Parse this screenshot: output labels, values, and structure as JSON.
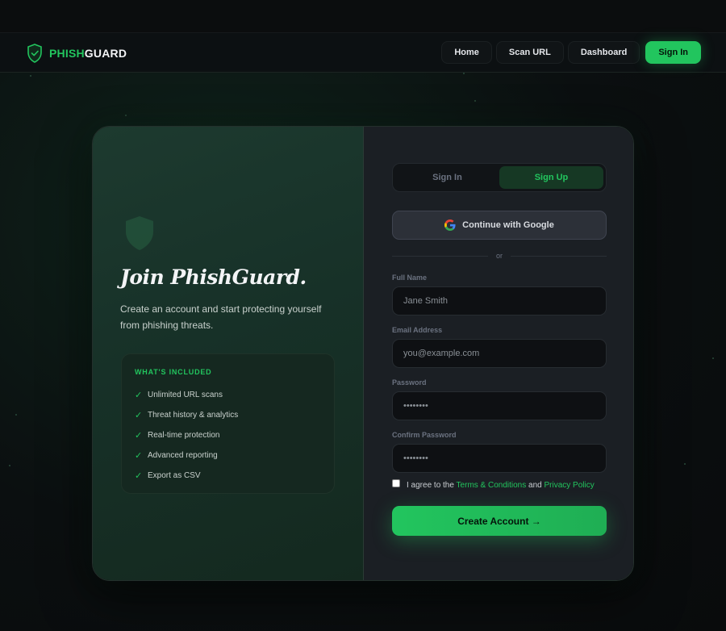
{
  "brand": {
    "part1": "PHISH",
    "part2": "GUARD",
    "accent": "#22c55e"
  },
  "nav": {
    "links": [
      "Home",
      "Scan URL",
      "Dashboard"
    ],
    "signin": "Sign In"
  },
  "promo": {
    "headline": "Join PhishGuard.",
    "subline": "Create an account and start protecting yourself from phishing threats.",
    "included_title": "WHAT'S INCLUDED",
    "items": [
      "Unlimited URL scans",
      "Threat history & analytics",
      "Real-time protection",
      "Advanced reporting",
      "Export as CSV"
    ]
  },
  "auth": {
    "tabs": [
      "Sign In",
      "Sign Up"
    ],
    "active_tab": "Sign Up",
    "google_label": "Continue with Google",
    "divider": "or",
    "fields": {
      "full_name": {
        "label": "Full Name",
        "placeholder": "Jane Smith"
      },
      "email": {
        "label": "Email Address",
        "placeholder": "you@example.com"
      },
      "password": {
        "label": "Password",
        "placeholder": "••••••••"
      },
      "confirm": {
        "label": "Confirm Password",
        "placeholder": "••••••••"
      }
    },
    "agree": {
      "prefix": "I agree to the",
      "terms": "Terms & Conditions",
      "and": "and",
      "privacy": "Privacy Policy"
    },
    "submit": "Create Account →"
  }
}
